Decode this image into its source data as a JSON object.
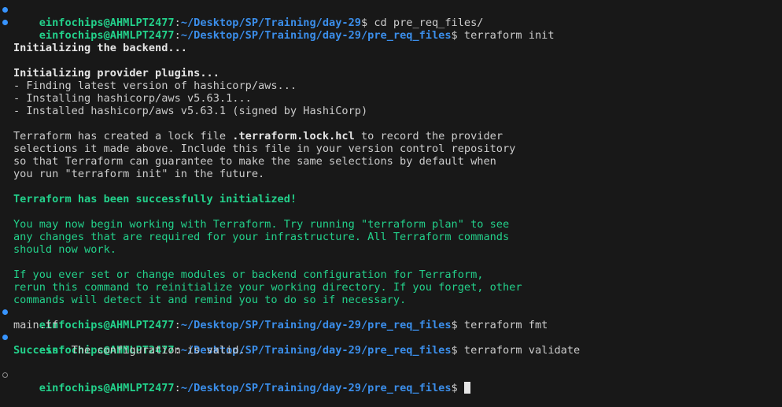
{
  "prompt": {
    "user": "einfochips@AHMLPT2477",
    "sep": ":",
    "path_day": "~/Desktop/SP/Training/day-29",
    "path_files": "~/Desktop/SP/Training/day-29/pre_req_files",
    "dollar": "$"
  },
  "commands": {
    "cd": "cd pre_req_files/",
    "init": "terraform init",
    "fmt": "terraform fmt",
    "validate": "terraform validate"
  },
  "init_output": {
    "backend": "Initializing the backend...",
    "plugins": "Initializing provider plugins...",
    "finding": "- Finding latest version of hashicorp/aws...",
    "installing": "- Installing hashicorp/aws v5.63.1...",
    "installed": "- Installed hashicorp/aws v5.63.1 (signed by HashiCorp)",
    "lock_pre": "Terraform has created a lock file ",
    "lock_file": ".terraform.lock.hcl",
    "lock_post": " to record the provider",
    "lock_2": "selections it made above. Include this file in your version control repository",
    "lock_3": "so that Terraform can guarantee to make the same selections by default when",
    "lock_4": "you run \"terraform init\" in the future.",
    "success": "Terraform has been successfully initialized!",
    "begin_1": "You may now begin working with Terraform. Try running \"terraform plan\" to see",
    "begin_2": "any changes that are required for your infrastructure. All Terraform commands",
    "begin_3": "should now work.",
    "reinit_1": "If you ever set or change modules or backend configuration for Terraform,",
    "reinit_2": "rerun this command to reinitialize your working directory. If you forget, other",
    "reinit_3": "commands will detect it and remind you to do so if necessary."
  },
  "fmt_output": {
    "file": "main.tf"
  },
  "validate_output": {
    "success": "Success!",
    "message": " The configuration is valid."
  },
  "colors": {
    "background": "#181818",
    "text": "#cccccc",
    "user_green": "#23d18b",
    "path_blue": "#3b8eea",
    "marker_blue": "#3794ff"
  }
}
